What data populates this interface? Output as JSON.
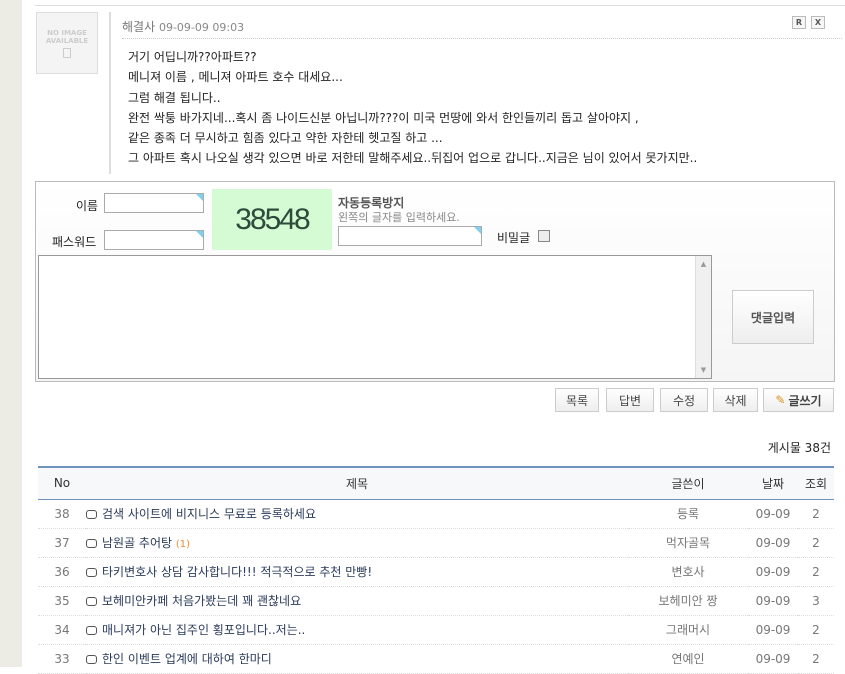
{
  "comment": {
    "author": "해결사",
    "datetime": "09-09-09 09:03",
    "avatar_text": "NO IMAGE AVAILABLE",
    "reply_btn": "R",
    "delete_btn": "X",
    "lines": [
      "거기 어딥니까??아파트??",
      "메니져 이름 , 메니져 아파트 호수 대세요...",
      "그럼 해결 됩니다..",
      "완전 싹퉁 바가지네...혹시 좀 나이드신분 아닙니까???이 미국 먼땅에 와서 한인들끼리 돕고 살아야지 ,",
      "같은 종족 더 무시하고 힘좀 있다고 약한 자한테 헷고질 하고 ...",
      "그 아파트 혹시 나오실 생각 있으면 바로 저한테 말해주세요..뒤집어 업으로 갑니다..지금은 님이 있어서 못가지만.."
    ]
  },
  "form": {
    "name_label": "이름",
    "password_label": "패스워드",
    "captcha": "38548",
    "captcha_title": "자동등록방지",
    "captcha_hint": "왼쪽의 글자를 입력하세요.",
    "secret_label": "비밀글",
    "submit": "댓글입력"
  },
  "actions": {
    "list": "목록",
    "reply": "답변",
    "edit": "수정",
    "delete": "삭제",
    "write": "글쓰기"
  },
  "board": {
    "count": "게시물 38건",
    "headers": [
      "No",
      "제목",
      "글쓴이",
      "날짜",
      "조회"
    ],
    "rows": [
      {
        "no": "38",
        "title": "검색 사이트에 비지니스 무료로 등록하세요",
        "replies": "",
        "author": "등록",
        "date": "09-09",
        "views": "2"
      },
      {
        "no": "37",
        "title": "남원골 추어탕",
        "replies": "(1)",
        "author": "먹자골목",
        "date": "09-09",
        "views": "2"
      },
      {
        "no": "36",
        "title": "타키변호사 상담 감사합니다!!! 적극적으로 추천 만빵!",
        "replies": "",
        "author": "변호사",
        "date": "09-09",
        "views": "2"
      },
      {
        "no": "35",
        "title": "보헤미안카페 처음가봤는데 꽤 괜찮네요",
        "replies": "",
        "author": "보헤미안 짱",
        "date": "09-09",
        "views": "3"
      },
      {
        "no": "34",
        "title": "매니져가 아닌 집주인 횡포입니다..저는..",
        "replies": "",
        "author": "그래머시",
        "date": "09-09",
        "views": "2"
      },
      {
        "no": "33",
        "title": "한인 이벤트 업계에 대하여 한마디",
        "replies": "",
        "author": "연예인",
        "date": "09-09",
        "views": "2"
      }
    ]
  }
}
